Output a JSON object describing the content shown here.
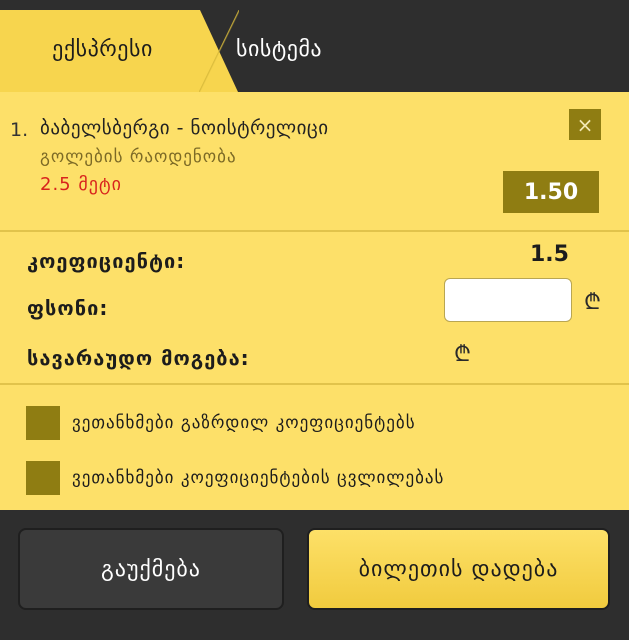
{
  "tabs": {
    "active_label": "ექსპრესი",
    "inactive_label": "სისტემა"
  },
  "bet": {
    "index": "1.",
    "match": "ბაბელსბერგი - ნოისტრელიცი",
    "market": "გოლების რაოდენობა",
    "pick": "2.5 მეტი",
    "odds": "1.50",
    "remove_icon": "×"
  },
  "summary": {
    "coefficient_label": "კოეფიციენტი:",
    "coefficient_value": "1.5",
    "stake_label": "ფსონი:",
    "stake_value": "",
    "potential_win_label": "სავარაუდო მოგება:",
    "currency_symbol": "₾"
  },
  "options": {
    "accept_increased": "ვეთანხმები გაზრდილ კოეფიციენტებს",
    "accept_changes": "ვეთანხმები კოეფიციენტების ცვლილებას"
  },
  "actions": {
    "cancel_label": "გაუქმება",
    "place_label": "ბილეთის დადება"
  },
  "colors": {
    "panel": "#fde069",
    "accent_dark": "#8f7d12",
    "bar": "#2e2e2e",
    "pick_red": "#d8231d"
  }
}
